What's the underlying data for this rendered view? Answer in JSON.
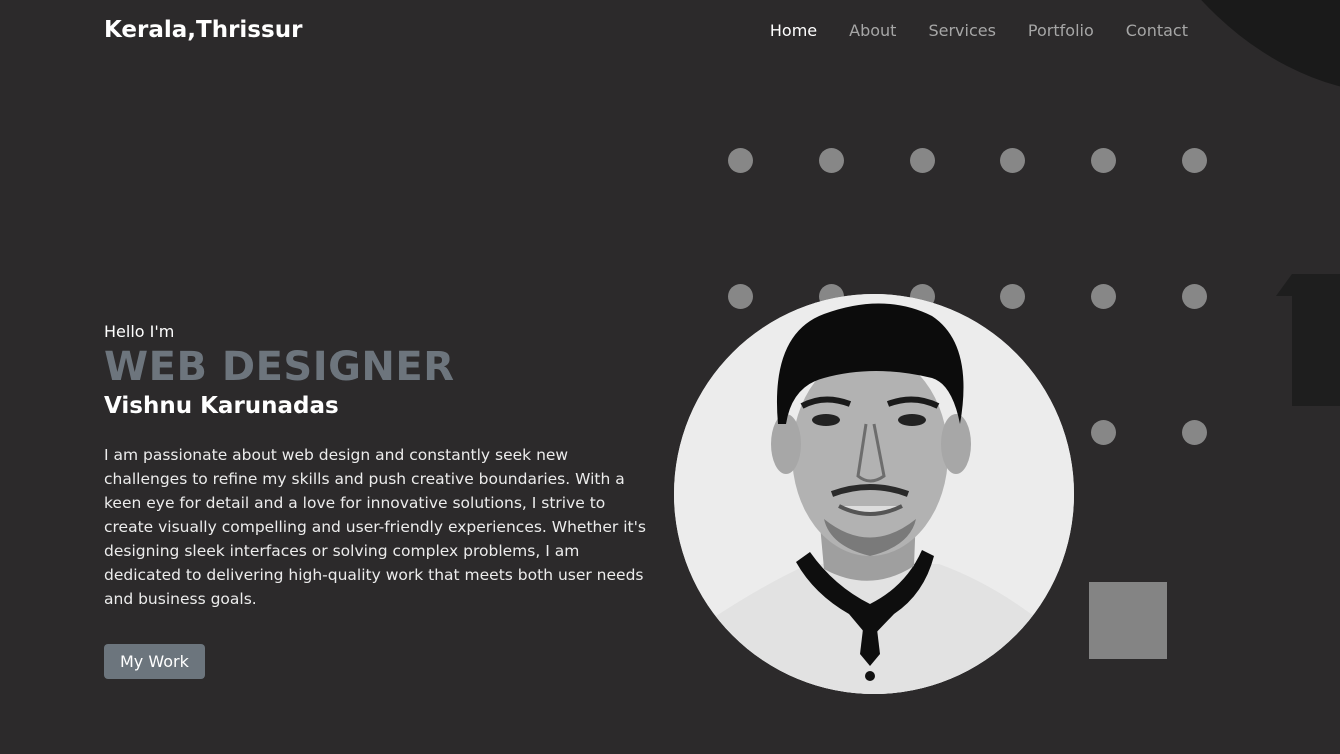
{
  "brand": "Kerala,Thrissur",
  "nav": {
    "items": [
      {
        "label": "Home",
        "active": true
      },
      {
        "label": "About",
        "active": false
      },
      {
        "label": "Services",
        "active": false
      },
      {
        "label": "Portfolio",
        "active": false
      },
      {
        "label": "Contact",
        "active": false
      }
    ]
  },
  "hero": {
    "greeting": "Hello I'm",
    "role": "WEB DESIGNER",
    "name": "Vishnu Karunadas",
    "bio": "I am passionate about web design and constantly seek new challenges to refine my skills and push creative boundaries. With a keen eye for detail and a love for innovative solutions, I strive to create visually compelling and user-friendly experiences. Whether it's designing sleek interfaces or solving complex problems, I am dedicated to delivering high-quality work that meets both user needs and business goals.",
    "cta_label": "My Work"
  },
  "colors": {
    "background": "#2c2a2b",
    "accent_gray": "#6c757d",
    "dot": "#878787",
    "portrait_bg": "#ebebeb"
  },
  "icons": {
    "portrait": "profile-photo"
  }
}
